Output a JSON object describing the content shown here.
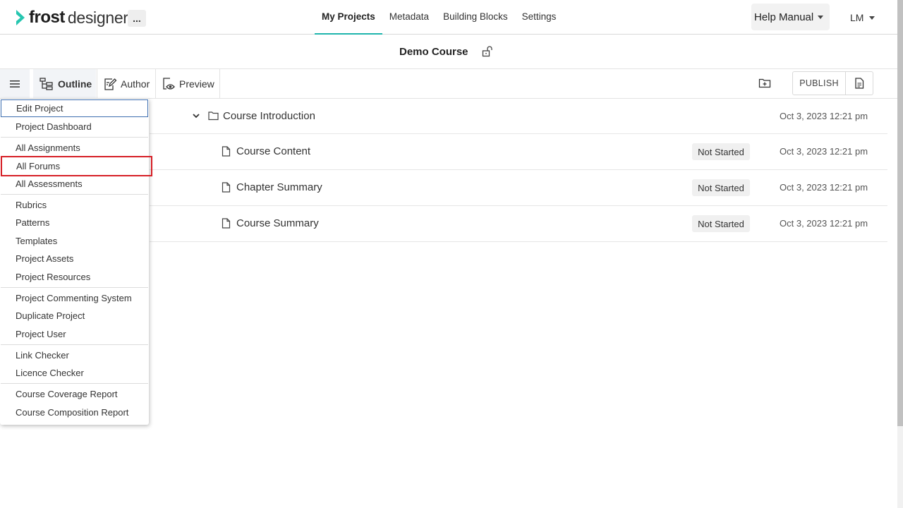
{
  "app": {
    "logo_frost": "frost",
    "logo_designer": "designer",
    "more_label": "...",
    "nav": [
      {
        "label": "My Projects",
        "active": true
      },
      {
        "label": "Metadata",
        "active": false
      },
      {
        "label": "Building Blocks",
        "active": false
      },
      {
        "label": "Settings",
        "active": false
      }
    ],
    "help_label": "Help Manual",
    "user_initials": "LM",
    "accent": "#1fb5ad",
    "logo_accent": "#26c6b0"
  },
  "course": {
    "title": "Demo Course"
  },
  "toolbar": {
    "outline_label": "Outline",
    "author_label": "Author",
    "preview_label": "Preview",
    "publish_label": "PUBLISH"
  },
  "outline": {
    "folder": {
      "label": "Course Introduction",
      "date": "Oct 3, 2023 12:21 pm"
    },
    "pages": [
      {
        "label": "Course Content",
        "status": "Not Started",
        "date": "Oct 3, 2023 12:21 pm"
      },
      {
        "label": "Chapter Summary",
        "status": "Not Started",
        "date": "Oct 3, 2023 12:21 pm"
      },
      {
        "label": "Course Summary",
        "status": "Not Started",
        "date": "Oct 3, 2023 12:21 pm"
      }
    ]
  },
  "menu": {
    "items": [
      "Edit Project",
      "Project Dashboard",
      "All Assignments",
      "All Forums",
      "All Assessments",
      "Rubrics",
      "Patterns",
      "Templates",
      "Project Assets",
      "Project Resources",
      "Project Commenting System",
      "Duplicate Project",
      "Project User",
      "Link Checker",
      "Licence Checker",
      "Course Coverage Report",
      "Course Composition Report"
    ],
    "highlighted_item": "All Forums",
    "highlight_color": "#d61f26"
  }
}
